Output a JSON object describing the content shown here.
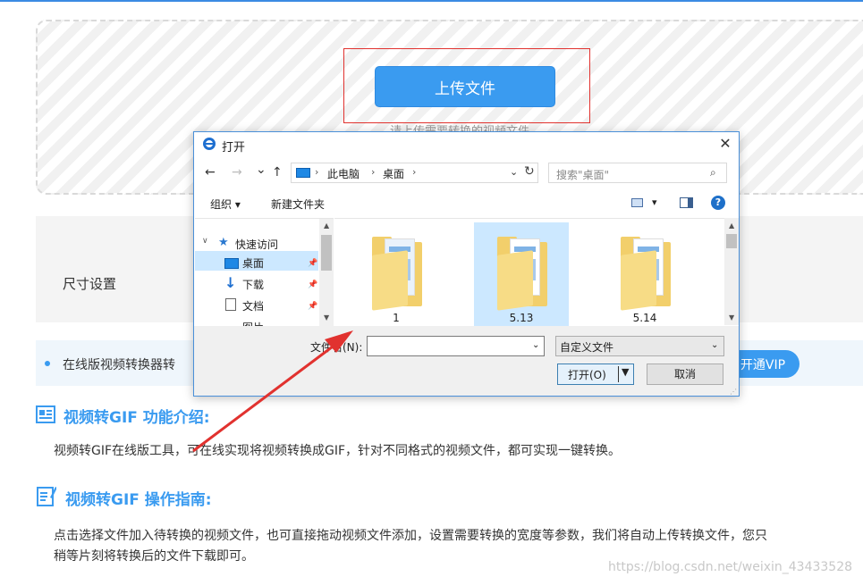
{
  "upload": {
    "button_label": "上传文件",
    "hint": "请上传需要转换的视频文件"
  },
  "settings": {
    "size_label": "尺寸设置"
  },
  "notice": {
    "text": "在线版视频转换器转",
    "vip_label": "开通VIP"
  },
  "sections": [
    {
      "icon": "doc-list-icon",
      "title": "视频转GIF 功能介绍:",
      "text": "视频转GIF在线版工具，可在线实现将视频转换成GIF，针对不同格式的视频文件，都可实现一键转换。"
    },
    {
      "icon": "doc-edit-icon",
      "title": "视频转GIF 操作指南:",
      "text_line1": "点击选择文件加入待转换的视频文件，也可直接拖动视频文件添加，设置需要转换的宽度等参数，我们将自动上传转换文件，您只",
      "text_line2": "稍等片刻将转换后的文件下载即可。"
    }
  ],
  "watermark": "https://blog.csdn.net/weixin_43433528",
  "dialog": {
    "title": "打开",
    "close": "✕",
    "nav": {
      "back": "←",
      "forward": "→",
      "dropdown": "⌄",
      "up": "↑"
    },
    "address": {
      "segments": [
        "此电脑",
        "桌面"
      ],
      "sep": "›",
      "dropdown": "⌄",
      "refresh": "↻"
    },
    "search": {
      "placeholder": "搜索\"桌面\"",
      "icon": "⌕"
    },
    "toolbar": {
      "organize": "组织 ▾",
      "new_folder": "新建文件夹",
      "view_drop": "▾",
      "help": "?"
    },
    "nav_pane": {
      "quick_access": "快速访问",
      "items": [
        "桌面",
        "下载",
        "文档",
        "图片"
      ]
    },
    "files": [
      {
        "name": "1"
      },
      {
        "name": "5.13",
        "selected": true
      },
      {
        "name": "5.14"
      }
    ],
    "filename_label": "文件名(N):",
    "filename_value": "",
    "filter": "自定义文件",
    "open_label": "打开(O)",
    "cancel_label": "取消"
  },
  "colors": {
    "accent": "#3a9bf0",
    "annotation": "#e1322f"
  }
}
